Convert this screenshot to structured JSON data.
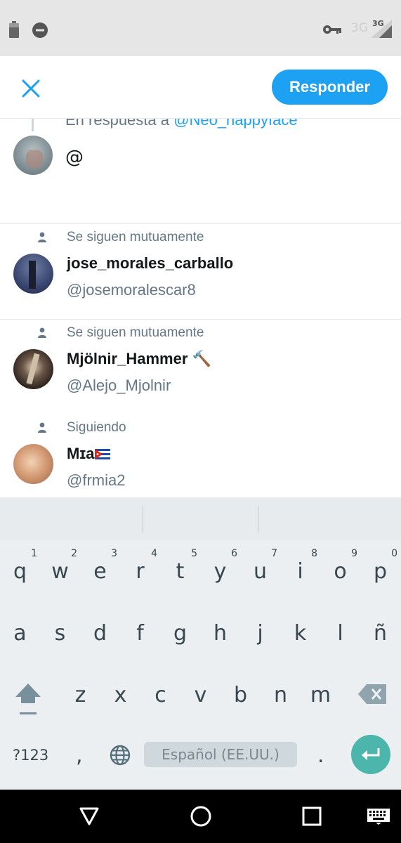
{
  "status_bar": {
    "icons": [
      "battery-icon",
      "do-not-disturb-icon",
      "vpn-key-icon",
      "signal-icon"
    ],
    "network_label": "3G",
    "network_small": "3G"
  },
  "header": {
    "close_icon": "close-icon",
    "reply_button": "Responder",
    "accent": "#1da1f2"
  },
  "compose": {
    "reply_context_prefix": "En respuesta a",
    "reply_context_handle": "@Neo_happyface",
    "text": "@"
  },
  "suggestions": [
    {
      "context": "Se siguen mutuamente",
      "name": "jose_morales_carballo",
      "name_emoji": "",
      "handle": "@josemoralescar8"
    },
    {
      "context": "Se siguen mutuamente",
      "name": "Mjölnir_Hammer",
      "name_emoji": "🔨",
      "handle": "@Alejo_Mjolnir"
    },
    {
      "context": "Siguiendo",
      "name": "Mɪa",
      "name_emoji": "🇨🇺",
      "handle": "@frmia2"
    }
  ],
  "keyboard": {
    "row1": [
      {
        "ch": "q",
        "num": "1"
      },
      {
        "ch": "w",
        "num": "2"
      },
      {
        "ch": "e",
        "num": "3"
      },
      {
        "ch": "r",
        "num": "4"
      },
      {
        "ch": "t",
        "num": "5"
      },
      {
        "ch": "y",
        "num": "6"
      },
      {
        "ch": "u",
        "num": "7"
      },
      {
        "ch": "i",
        "num": "8"
      },
      {
        "ch": "o",
        "num": "9"
      },
      {
        "ch": "p",
        "num": "0"
      }
    ],
    "row2": [
      "a",
      "s",
      "d",
      "f",
      "g",
      "h",
      "j",
      "k",
      "l",
      "ñ"
    ],
    "row3": [
      "z",
      "x",
      "c",
      "v",
      "b",
      "n",
      "m"
    ],
    "symbols_label": "?123",
    "comma": ",",
    "space_label": "Español (EE.UU.)",
    "period": ".",
    "enter_color": "#4db6ac"
  },
  "nav_bar": {
    "icons": [
      "back-icon",
      "home-icon",
      "recents-icon",
      "keyboard-switch-icon"
    ]
  }
}
